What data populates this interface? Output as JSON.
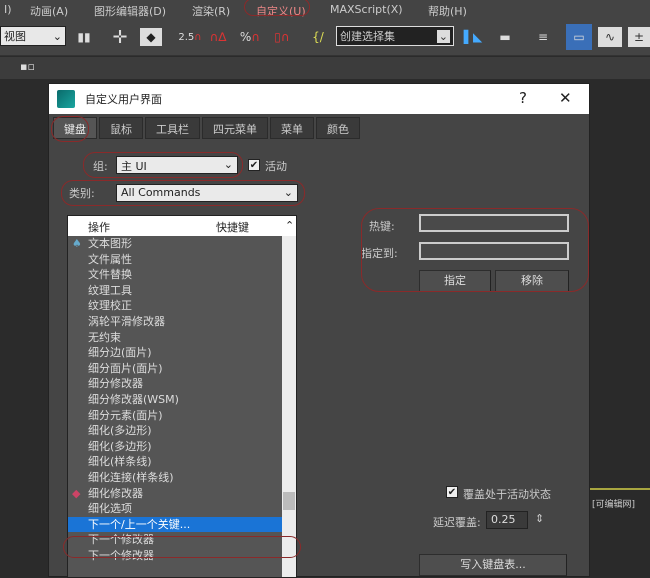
{
  "menubar": {
    "items": [
      "I)",
      "动画(A)",
      "图形编辑器(D)",
      "渲染(R)",
      "自定义(U)",
      "MAXScript(X)",
      "帮助(H)"
    ]
  },
  "toolbar": {
    "view_combo": "视图",
    "snap_angle": "2.5",
    "percent": "%",
    "selection_set": "创建选择集"
  },
  "viewport": {
    "label": "[可编辑网]"
  },
  "dialog": {
    "title": "自定义用户界面",
    "help": "?",
    "close": "✕",
    "tabs": [
      "键盘",
      "鼠标",
      "工具栏",
      "四元菜单",
      "菜单",
      "颜色"
    ],
    "active_tab": 0,
    "group_label": "组:",
    "group_value": "主 UI",
    "active_label": "活动",
    "active_checked": true,
    "category_label": "类别:",
    "category_value": "All Commands",
    "list_headers": [
      "操作",
      "快捷键"
    ],
    "list_items": [
      "文本图形",
      "文件属性",
      "文件替换",
      "纹理工具",
      "纹理校正",
      "涡轮平滑修改器",
      "无约束",
      "细分边(面片)",
      "细分面片(面片)",
      "细分修改器",
      "细分修改器(WSM)",
      "细分元素(面片)",
      "细化(多边形)",
      "细化(多边形)",
      "细化(样条线)",
      "细化连接(样条线)",
      "细化修改器",
      "细化选项",
      "下一个/上一个关键...",
      "下一个修改器",
      "下一个修改器"
    ],
    "selected_index": 18,
    "hotkey_label": "热键:",
    "hotkey_value": "",
    "assigned_label": "指定到:",
    "assigned_value": "",
    "assign_button": "指定",
    "remove_button": "移除",
    "override_label": "覆盖处于活动状态",
    "override_checked": true,
    "delay_label": "延迟覆盖:",
    "delay_value": "0.25",
    "write_button": "写入键盘表...",
    "colors": {
      "accent": "#1a74d6",
      "highlight_oval": "#8a2a2a"
    }
  }
}
